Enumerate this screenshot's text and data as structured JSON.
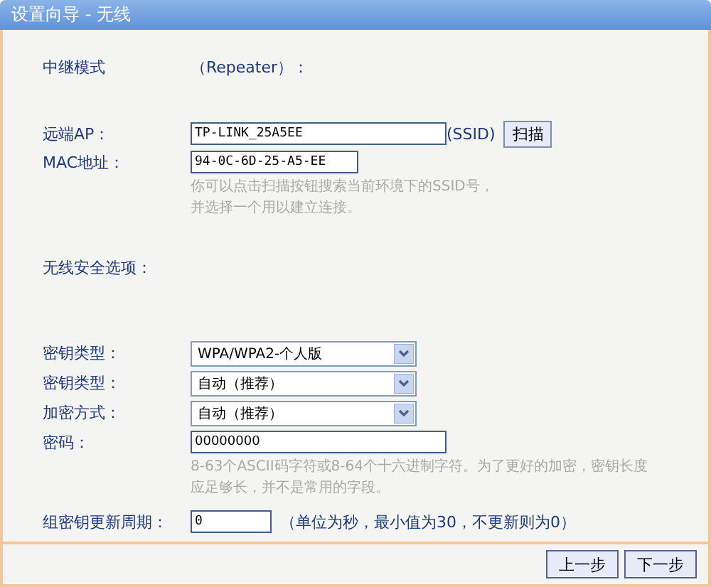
{
  "window": {
    "title": "设置向导 - 无线"
  },
  "mode": {
    "label": "中继模式",
    "value": "（Repeater）："
  },
  "remote_ap": {
    "label": "远端AP：",
    "value": "TP-LINK_25A5EE",
    "suffix": "(SSID)",
    "button": "扫描"
  },
  "mac": {
    "label": "MAC地址：",
    "value": "94-0C-6D-25-A5-EE"
  },
  "scan_hint": [
    "你可以点击扫描按钮搜索当前环境下的SSID号，",
    "并选择一个用以建立连接。"
  ],
  "security": {
    "heading": "无线安全选项：",
    "selects": [
      {
        "label": "密钥类型：",
        "value": "WPA/WPA2-个人版"
      },
      {
        "label": "密钥类型：",
        "value": "自动（推荐）"
      },
      {
        "label": "加密方式：",
        "value": "自动（推荐）"
      }
    ],
    "password": {
      "label": "密码：",
      "value": "00000000"
    },
    "password_hint": [
      "8-63个ASCII码字符或8-64个十六进制字符。为了更好的加密，密钥长度",
      "应足够长，并不是常用的字段。"
    ],
    "group_key": {
      "label": "组密钥更新周期：",
      "value": "0",
      "note": "（单位为秒，最小值为30，不更新则为0）"
    }
  },
  "buttons": [
    "上一步",
    "下一步"
  ]
}
